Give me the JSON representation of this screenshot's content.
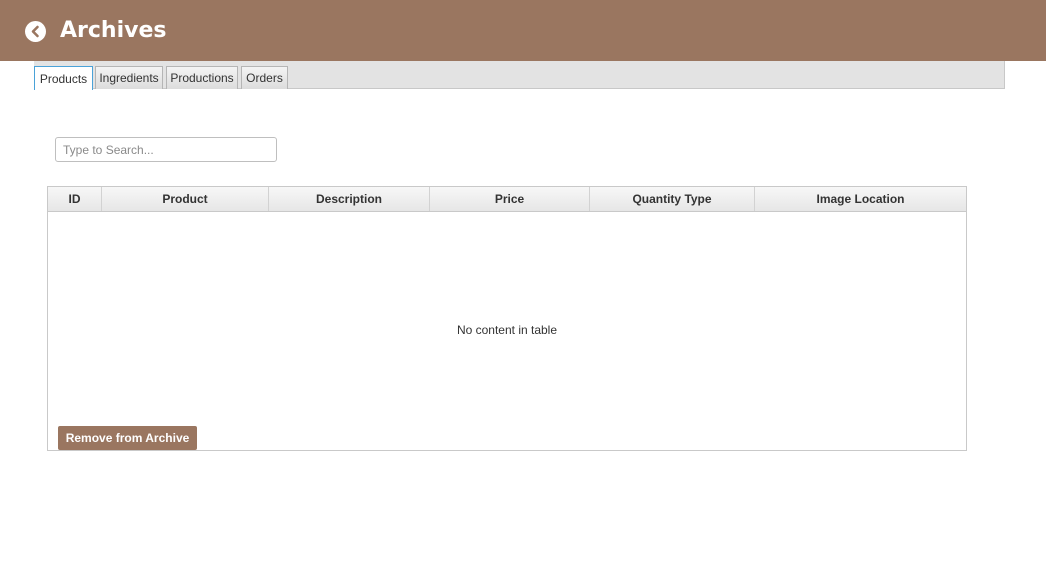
{
  "header": {
    "title": "Archives",
    "back_icon": "chevron-left-icon"
  },
  "tabs": [
    {
      "label": "Products",
      "active": true
    },
    {
      "label": "Ingredients",
      "active": false
    },
    {
      "label": "Productions",
      "active": false
    },
    {
      "label": "Orders",
      "active": false
    }
  ],
  "search": {
    "placeholder": "Type to Search...",
    "value": ""
  },
  "table": {
    "columns": [
      "ID",
      "Product",
      "Description",
      "Price",
      "Quantity Type",
      "Image Location"
    ],
    "rows": [],
    "empty_text": "No content in table"
  },
  "actions": {
    "remove_label": "Remove from Archive"
  },
  "colors": {
    "accent": "#9a7660",
    "active_tab_border": "#4aa2d8"
  }
}
